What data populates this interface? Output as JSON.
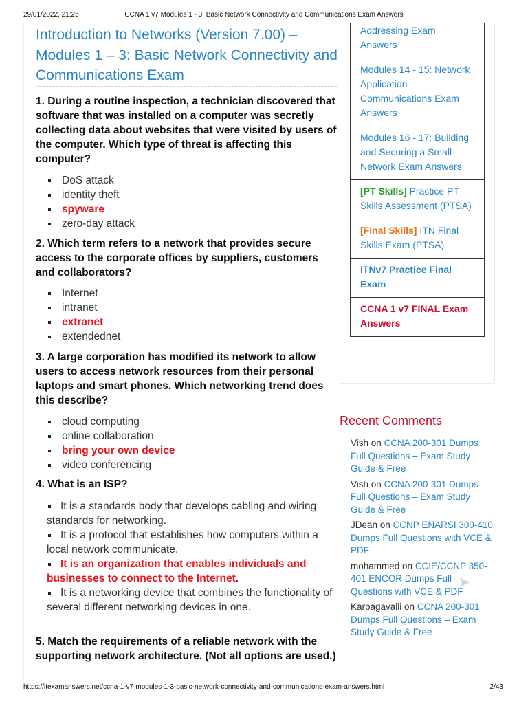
{
  "print_header": {
    "datetime": "29/01/2022, 21:25",
    "doc_title": "CCNA 1 v7 Modules 1 - 3: Basic Network Connectivity and Communications Exam Answers"
  },
  "print_footer": {
    "url": "https://itexamanswers.net/ccna-1-v7-modules-1-3-basic-network-connectivity-and-communications-exam-answers.html",
    "page": "2/43"
  },
  "article": {
    "title": "Introduction to Networks (Version 7.00) – Modules 1 – 3: Basic Network Connectivity and Communications Exam",
    "questions": [
      {
        "text": "1. During a routine inspection, a technician discovered that software that was installed on a computer was secretly collecting data about websites that were visited by users of the computer. Which type of threat is affecting this computer?",
        "options": [
          {
            "text": "DoS attack",
            "correct": false
          },
          {
            "text": "identity theft",
            "correct": false
          },
          {
            "text": "spyware",
            "correct": true
          },
          {
            "text": "zero-day attack",
            "correct": false
          }
        ]
      },
      {
        "text": "2. Which term refers to a network that provides secure access to the corporate offices by suppliers, customers and collaborators?",
        "options": [
          {
            "text": "Internet",
            "correct": false
          },
          {
            "text": "intranet",
            "correct": false
          },
          {
            "text": "extranet",
            "correct": true
          },
          {
            "text": "extendednet",
            "correct": false
          }
        ]
      },
      {
        "text": "3. A large corporation has modified its network to allow users to access network resources from their personal laptops and smart phones. Which networking trend does this describe?",
        "options": [
          {
            "text": "cloud computing",
            "correct": false
          },
          {
            "text": "online collaboration",
            "correct": false
          },
          {
            "text": "bring your own device",
            "correct": true
          },
          {
            "text": "video conferencing",
            "correct": false
          }
        ]
      },
      {
        "text": "4. What is an ISP?",
        "options": [
          {
            "text": "It is a standards body that develops cabling and wiring standards for networking.",
            "correct": false
          },
          {
            "text": "It is a protocol that establishes how computers within a local network communicate.",
            "correct": false
          },
          {
            "text": "It is an organization that enables individuals and businesses to connect to the Internet.",
            "correct": true
          },
          {
            "text": "It is a networking device that combines the functionality of several different networking devices in one.",
            "correct": false
          }
        ]
      },
      {
        "text": "5. Match the requirements of a reliable network with the supporting network architecture. (Not all options are used.)",
        "options": []
      }
    ]
  },
  "sidebar": {
    "menu": [
      {
        "tag": "",
        "text": "Addressing Exam Answers",
        "style": "link"
      },
      {
        "tag": "",
        "text": "Modules 14 - 15: Network Application Communications Exam Answers",
        "style": "link"
      },
      {
        "tag": "",
        "text": "Modules 16 - 17: Building and Securing a Small Network Exam Answers",
        "style": "link"
      },
      {
        "tag": "[PT Skills]",
        "text": " Practice PT Skills Assessment (PTSA)",
        "style": "green-tag"
      },
      {
        "tag": "[Final Skills]",
        "text": " ITN Final Skills Exam (PTSA)",
        "style": "orange-tag"
      },
      {
        "tag": "",
        "text": "ITNv7 Practice Final Exam",
        "style": "bold-blue"
      },
      {
        "tag": "",
        "text": "CCNA 1 v7 FINAL Exam Answers",
        "style": "bold-red"
      }
    ],
    "recent_comments_title": "Recent Comments",
    "on_word": " on ",
    "recent_comments": [
      {
        "author": "Vish",
        "post": "CCNA 200-301 Dumps Full Questions – Exam Study Guide & Free"
      },
      {
        "author": "Vish",
        "post": "CCNA 200-301 Dumps Full Questions – Exam Study Guide & Free"
      },
      {
        "author": "JDean",
        "post": "CCNP ENARSI 300-410 Dumps Full Questions with VCE & PDF"
      },
      {
        "author": "mohammed",
        "post": "CCIE/CCNP 350-401 ENCOR Dumps Full Questions with VCE & PDF"
      },
      {
        "author": "Karpagavalli",
        "post": "CCNA 200-301 Dumps Full Questions – Exam Study Guide & Free"
      }
    ]
  },
  "colors": {
    "link_blue": "#2b86c5",
    "correct_red": "#e8161d",
    "heading_red": "#c8102e",
    "tag_green": "#2a9d2a",
    "tag_orange": "#e8731a"
  }
}
